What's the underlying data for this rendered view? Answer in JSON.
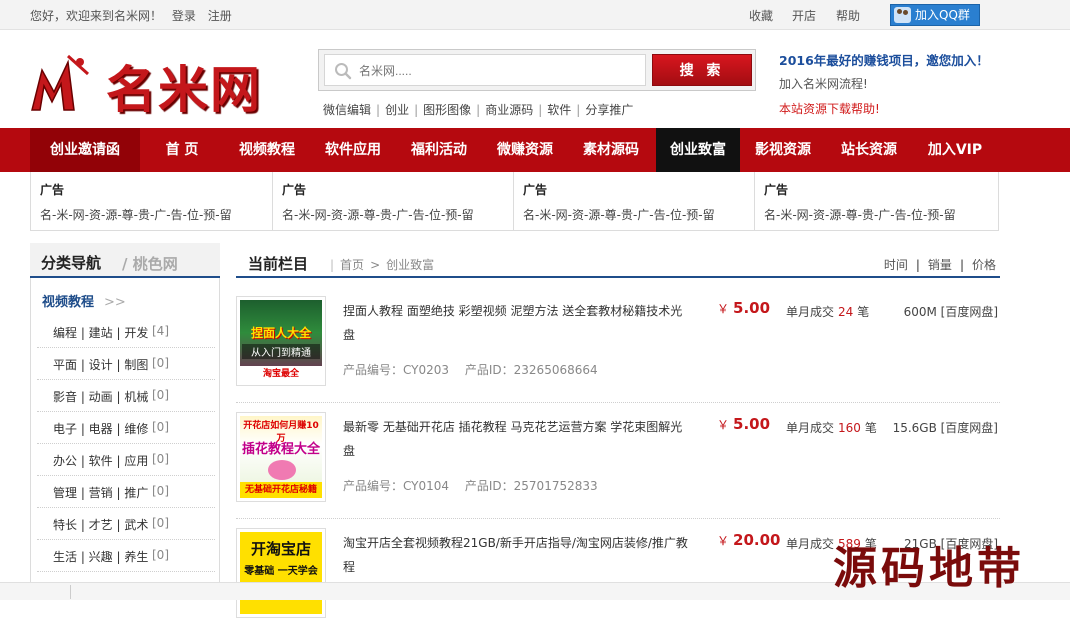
{
  "topbar": {
    "welcome": "您好，欢迎来到名米网！",
    "login": "登录",
    "register": "注册",
    "favorite": "收藏",
    "open_shop": "开店",
    "help": "帮助",
    "qq_group": "加入QQ群"
  },
  "logo": {
    "text": "名米网"
  },
  "search": {
    "placeholder": "名米网.....",
    "button": "搜 索",
    "hot_links": [
      "微信编辑",
      "创业",
      "图形图像",
      "商业源码",
      "软件",
      "分享推广"
    ]
  },
  "promo": {
    "line1": "2016年最好的赚钱项目，邀您加入！",
    "line2": "加入名米网流程!",
    "line3": "本站资源下载帮助!"
  },
  "nav": {
    "items": [
      "创业邀请函",
      "首 页",
      "视频教程",
      "软件应用",
      "福利活动",
      "微赚资源",
      "素材源码",
      "创业致富",
      "影视资源",
      "站长资源",
      "加入VIP"
    ]
  },
  "ads": [
    {
      "title": "广告",
      "desc": "名-米-网-资-源-尊-贵-广-告-位-预-留"
    },
    {
      "title": "广告",
      "desc": "名-米-网-资-源-尊-贵-广-告-位-预-留"
    },
    {
      "title": "广告",
      "desc": "名-米-网-资-源-尊-贵-广-告-位-预-留"
    },
    {
      "title": "广告",
      "desc": "名-米-网-资-源-尊-贵-广-告-位-预-留"
    }
  ],
  "sidebar": {
    "title": "分类导航",
    "subtitle": "/ 桃色网",
    "category": "视频教程",
    "category_arrow": ">>",
    "rows": [
      {
        "label": "编程 | 建站 | 开发",
        "count": "[4]"
      },
      {
        "label": "平面 | 设计 | 制图",
        "count": "[0]"
      },
      {
        "label": "影音 | 动画 | 机械",
        "count": "[0]"
      },
      {
        "label": "电子 | 电器 | 维修",
        "count": "[0]"
      },
      {
        "label": "办公 | 软件 | 应用",
        "count": "[0]"
      },
      {
        "label": "管理 | 营销 | 推广",
        "count": "[0]"
      },
      {
        "label": "特长 | 才艺 | 武术",
        "count": "[0]"
      },
      {
        "label": "生活 | 兴趣 | 养生",
        "count": "[0]"
      }
    ]
  },
  "main": {
    "title": "当前栏目",
    "breadcrumb": [
      "首页",
      ">",
      "创业致富"
    ],
    "sorts": [
      "时间",
      "销量",
      "价格"
    ],
    "products": [
      {
        "name": "捏面人教程 面塑绝技 彩塑视频 泥塑方法 送全套教材秘籍技术光盘",
        "code": "产品编号：CY0203",
        "pid": "产品ID：23265068664",
        "currency": "￥",
        "price": "5.00",
        "sold_prefix": "单月成交",
        "sold": "24",
        "sold_suffix": "笔",
        "size": "600M [百度网盘]",
        "thumb_text_top": "捏面人大全",
        "thumb_text_mid": "从入门到精通",
        "thumb_text_bottom": "淘宝最全"
      },
      {
        "name": "最新零 无基础开花店 插花教程 马克花艺运营方案 学花束图解光盘",
        "code": "产品编号：CY0104",
        "pid": "产品ID：25701752833",
        "currency": "￥",
        "price": "5.00",
        "sold_prefix": "单月成交",
        "sold": "160",
        "sold_suffix": "笔",
        "size": "15.6GB [百度网盘]",
        "thumb_text_top": "开花店如何月赚10万",
        "thumb_text_mid": "插花教程大全",
        "thumb_text_bottom": "无基础开花店秘籍"
      },
      {
        "name": "淘宝开店全套视频教程21GB/新手开店指导/淘宝网店装修/推广教程",
        "code": "",
        "pid": "",
        "currency": "￥",
        "price": "20.00",
        "sold_prefix": "单月成交",
        "sold": "589",
        "sold_suffix": "笔",
        "size": "21GB [百度网盘]",
        "thumb_text_top": "开淘宝店",
        "thumb_text_mid": "零基础 一天学会",
        "thumb_text_bottom": ""
      }
    ]
  },
  "watermark": "源码地带",
  "colors": {
    "brand_red": "#b5090f",
    "link_blue": "#1f4d8a",
    "price_red": "#c4171b"
  }
}
